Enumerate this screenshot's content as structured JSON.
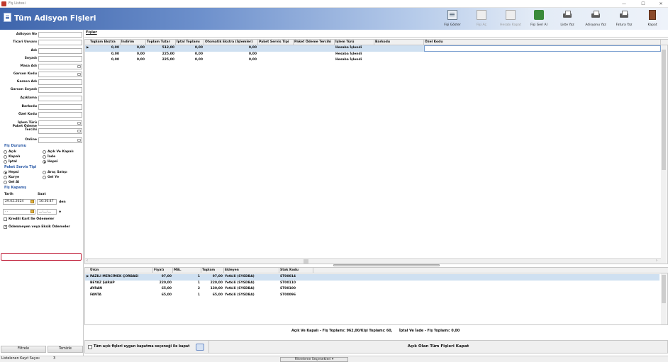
{
  "window": {
    "title": "Fiş Listesi",
    "controls": [
      "—",
      "☐",
      "✕"
    ]
  },
  "header": {
    "title": "Tüm Adisyon Fişleri"
  },
  "toolbar": [
    {
      "label": "Fişi Göster",
      "icon": "document-icon",
      "enabled": true
    },
    {
      "label": "Fişi Aç",
      "icon": "document-icon",
      "enabled": false
    },
    {
      "label": "Hesabı Kapat",
      "icon": "calculator-icon",
      "enabled": false
    },
    {
      "label": "Fişi Geri Al",
      "icon": "undo-icon",
      "enabled": true
    },
    {
      "label": "Liste Yaz",
      "icon": "printer-icon",
      "enabled": true
    },
    {
      "label": "Adisyonu Yaz",
      "icon": "printer-icon",
      "enabled": true
    },
    {
      "label": "Fatura Yaz",
      "icon": "printer-icon",
      "enabled": true
    },
    {
      "label": "Kapat",
      "icon": "exit-door-icon",
      "enabled": true
    }
  ],
  "filters": {
    "fields": [
      {
        "label": "Adisyon No",
        "dropdown": false
      },
      {
        "label": "Ticari Unvanı",
        "dropdown": false
      },
      {
        "label": "Adı",
        "dropdown": false
      },
      {
        "label": "Soyadı",
        "dropdown": false
      },
      {
        "label": "Masa Adı",
        "dropdown": true
      },
      {
        "label": "Garson Kodu",
        "dropdown": true
      },
      {
        "label": "Garson Adı",
        "dropdown": false
      },
      {
        "label": "Garson Soyadı",
        "dropdown": false
      },
      {
        "label": "Açıklama",
        "dropdown": false
      },
      {
        "label": "Barkodu",
        "dropdown": false
      },
      {
        "label": "Özel Kodu",
        "dropdown": false
      },
      {
        "label": "İşlem Türü",
        "dropdown": true
      },
      {
        "label": "Paket Ödeme Tercihi",
        "dropdown": true
      },
      {
        "label": "Online",
        "dropdown": true
      }
    ],
    "fis_durumu": {
      "title": "Fiş Durumu",
      "options": [
        "Açık",
        "Kapalı",
        "İptal",
        "Açık Ve Kapalı",
        "İade",
        "Hepsi"
      ],
      "selected": "Hepsi"
    },
    "paket_servis": {
      "title": "Paket Servis Tipi",
      "options": [
        "Hepsi",
        "Kurye",
        "Gel Al",
        "Araç Satışı",
        "Gel Ye"
      ],
      "selected": "Hepsi"
    },
    "fis_kapanis": {
      "title": "Fiş Kapanış",
      "tarih_label": "Tarih",
      "saat_label": "Saat",
      "date_from": "29.02.2024",
      "time_from": "16:36:47",
      "from_suffix": "den",
      "date_to": ". .",
      "time_to": "__:__:__",
      "to_suffix": "e"
    },
    "kredi_karti": {
      "label": "Kredili Kart İle Ödemeler",
      "checked": false
    },
    "odenmeyen": {
      "label": "Ödenmeyen veya Eksik Ödemeler",
      "checked": true
    },
    "filter_button": "Filtrele",
    "clear_button": "Temizle"
  },
  "tabs": [
    "Fişler"
  ],
  "main_grid": {
    "columns": [
      "Toplam Ekstra",
      "İndirim",
      "Toplam Tutar",
      "İptal Toplamı",
      "Otomatik Ekstra (İşlemler)",
      "Paket Servis Tipi",
      "Paket Ödeme Tercihi",
      "İşlem Türü",
      "Barkodu",
      "Özel Kodu"
    ],
    "rows": [
      [
        "0,00",
        "0,00",
        "512,00",
        "0,00",
        "0,00",
        "",
        "",
        "Hesaba İşlendi",
        "",
        ""
      ],
      [
        "0,00",
        "0,00",
        "225,00",
        "0,00",
        "0,00",
        "",
        "",
        "Hesaba İşlendi",
        "",
        ""
      ],
      [
        "0,00",
        "0,00",
        "225,00",
        "0,00",
        "0,00",
        "",
        "",
        "Hesaba İşlendi",
        "",
        ""
      ]
    ]
  },
  "detail_grid": {
    "columns": [
      "Ürün",
      "Fiyatı",
      "Mik.",
      "Toplam",
      "Ekleyen",
      "Stok Kodu"
    ],
    "rows": [
      [
        "PAZILI MERCİMEK ÇORBASI",
        "97,00",
        "1",
        "97,00",
        "Yetkili (SYSDBA)",
        "ST00014"
      ],
      [
        "BEYAZ ŞARAP",
        "220,00",
        "1",
        "220,00",
        "Yetkili (SYSDBA)",
        "ST00110"
      ],
      [
        "AYRAN",
        "65,00",
        "2",
        "130,00",
        "Yetkili (SYSDBA)",
        "ST00100"
      ],
      [
        "FANTA",
        "65,00",
        "1",
        "65,00",
        "Yetkili (SYSDBA)",
        "ST00096"
      ]
    ]
  },
  "summary": {
    "acik_kapali": "Açık Ve Kapalı - Fiş Toplamı: 962,00/Kişi Toplamı: 60,",
    "iptal_iade": "İptal Ve İade - Fiş Toplamı: 0,00"
  },
  "bottom": {
    "checkbox_label": "Tüm açık fişleri uygun kapatma seçeneği ile kapat",
    "close_all_button": "Açık Olan Tüm Fişleri Kapat"
  },
  "status": {
    "records_label": "Listelenen Kayıt Sayısı",
    "records_count": "3",
    "filter_options": "Filtreleme Seçenekleri"
  }
}
